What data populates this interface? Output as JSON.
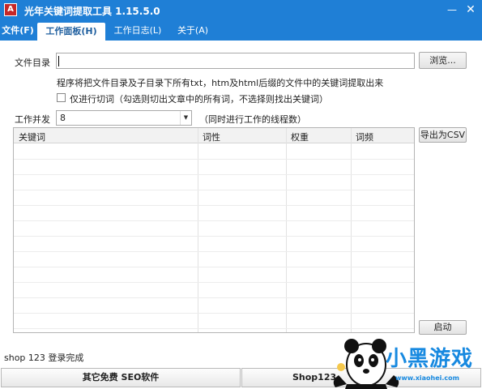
{
  "window": {
    "icon_glyph": "A",
    "title": "光年关键词提取工具 1.15.5.0",
    "minimize_glyph": "—",
    "close_glyph": "✕"
  },
  "menu": {
    "file": "文件(F)",
    "tabs": [
      {
        "label": "工作面板(H)",
        "active": true
      },
      {
        "label": "工作日志(L)",
        "active": false
      },
      {
        "label": "关于(A)",
        "active": false
      }
    ]
  },
  "form": {
    "dir_label": "文件目录",
    "dir_value": "",
    "browse_label": "浏览...",
    "description": "程序将把文件目录及子目录下所有txt，htm及html后缀的文件中的关键词提取出来",
    "segment_checkbox_checked": false,
    "segment_label": "仅进行切词（勾选则切出文章中的所有词，不选择则找出关键词）",
    "concurrency_label": "工作并发",
    "concurrency_value": "8",
    "concurrency_note": "（同时进行工作的线程数）"
  },
  "table": {
    "columns": [
      "关键词",
      "词性",
      "权重",
      "词频"
    ],
    "rows": []
  },
  "actions": {
    "export_csv": "导出为CSV",
    "start": "启动"
  },
  "status": {
    "text": "shop 123 登录完成"
  },
  "bottom": {
    "seo_button": "其它免费 SEO软件",
    "shop_button": "Shop123"
  },
  "watermark": {
    "logo_text": "小黑游戏",
    "url_text": "www.xiaohei.com"
  },
  "colors": {
    "titlebar": "#1f7fd6",
    "watermark": "#1789e0"
  },
  "icons": [
    "app-icon",
    "minimize-icon",
    "close-icon",
    "dropdown-arrow-icon",
    "panda-mascot-icon"
  ]
}
